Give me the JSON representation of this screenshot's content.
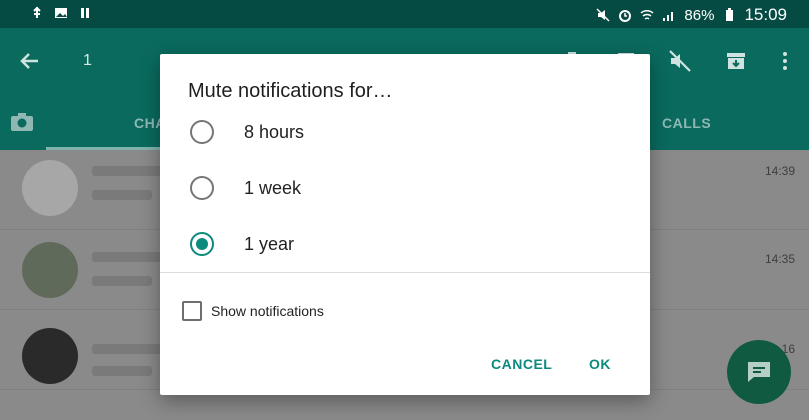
{
  "status_bar": {
    "battery": "86%",
    "time": "15:09",
    "left_icons": [
      "usb-icon",
      "image-icon",
      "pause-icon"
    ],
    "right_icons": [
      "mute-icon",
      "alarm-icon",
      "wifi-icon",
      "signal-icon",
      "battery-icon"
    ]
  },
  "app_bar": {
    "selected_count": "1",
    "icons": [
      "back-arrow-icon",
      "pin-icon",
      "delete-icon",
      "mute-icon",
      "archive-icon",
      "more-vert-icon"
    ]
  },
  "tabs": [
    {
      "label": "CHA"
    },
    {
      "label": "CALLS"
    }
  ],
  "chats": [
    {
      "time": "14:39"
    },
    {
      "time": "14:35"
    },
    {
      "time": "16"
    }
  ],
  "dialog": {
    "title": "Mute notifications for…",
    "options": [
      {
        "label": "8 hours",
        "selected": false
      },
      {
        "label": "1 week",
        "selected": false
      },
      {
        "label": "1 year",
        "selected": true
      }
    ],
    "checkbox_label": "Show notifications",
    "checkbox_checked": false,
    "cancel_label": "CANCEL",
    "ok_label": "OK"
  },
  "colors": {
    "accent": "#0b8a7d",
    "app_bar": "#0a6a5e",
    "status_bar": "#064b43"
  }
}
